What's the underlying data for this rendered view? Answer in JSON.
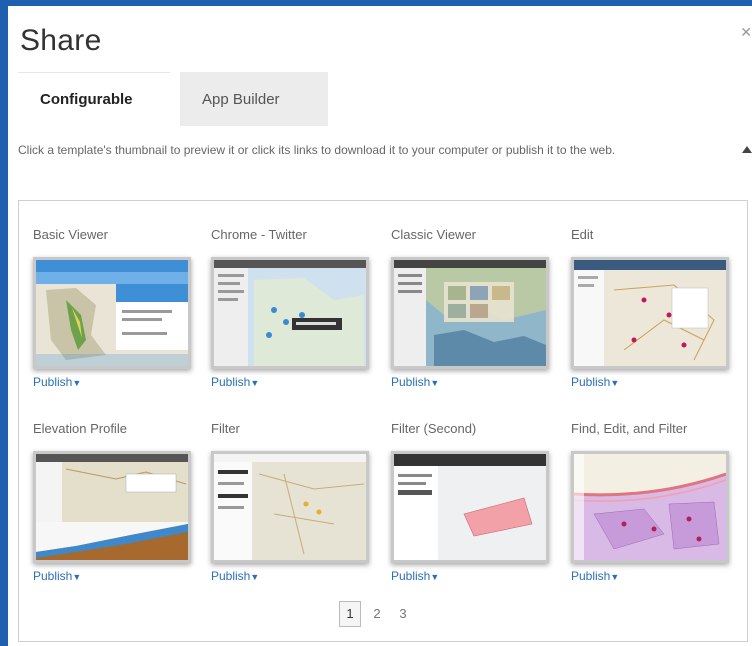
{
  "dialog": {
    "title": "Share",
    "tabs": [
      {
        "label": "Configurable"
      },
      {
        "label": "App Builder"
      }
    ],
    "description": "Click a template's thumbnail to preview it or click its links to download it to your computer or publish it to the web."
  },
  "templates": [
    {
      "title": "Basic Viewer",
      "action": "Publish"
    },
    {
      "title": "Chrome - Twitter",
      "action": "Publish"
    },
    {
      "title": "Classic Viewer",
      "action": "Publish"
    },
    {
      "title": "Edit",
      "action": "Publish"
    },
    {
      "title": "Elevation Profile",
      "action": "Publish"
    },
    {
      "title": "Filter",
      "action": "Publish"
    },
    {
      "title": "Filter (Second)",
      "action": "Publish"
    },
    {
      "title": "Find, Edit, and Filter",
      "action": "Publish"
    }
  ],
  "pagination": {
    "pages": [
      "1",
      "2",
      "3"
    ],
    "current": "1"
  },
  "icons": {
    "close": "close-icon",
    "caret": "caret-down-icon",
    "scroll": "scroll-up-arrow-icon"
  },
  "colors": {
    "background": "#1f5fb0",
    "link": "#2b6fb8"
  }
}
